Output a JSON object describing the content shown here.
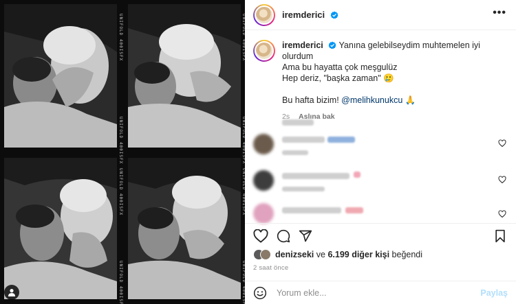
{
  "post": {
    "username": "iremderici",
    "caption": {
      "username": "iremderici",
      "line1": "Yanına gelebilseydim muhtemelen iyi olurdum",
      "line2": "Ama bu hayatta çok meşgulüz",
      "line3": "Hep deriz, \"başka zaman\" 🥲",
      "line4_text": "Bu hafta bizim! ",
      "mention": "@melihkunukcu",
      "line4_emoji": "🙏",
      "age": "2s",
      "see_translation": "Aslına bak"
    },
    "film_label": "UNIFOLD 400ISFX",
    "likes": {
      "first_liker": "denizseki",
      "connector": " ve ",
      "others": "6.199 diğer kişi",
      "suffix": " beğendi"
    },
    "time_ago": "2 saat önce",
    "comment_placeholder": "Yorum ekle...",
    "post_label": "Paylaş"
  },
  "colors": {
    "verified": "#0095f6",
    "mention": "#00376b",
    "muted": "#8e8e8e",
    "post_disabled": "#b2dffc"
  },
  "icons": [
    "verified-badge-icon",
    "more-options-icon",
    "heart-icon",
    "comment-icon",
    "share-icon",
    "bookmark-icon",
    "emoji-icon",
    "user-tag-icon"
  ]
}
